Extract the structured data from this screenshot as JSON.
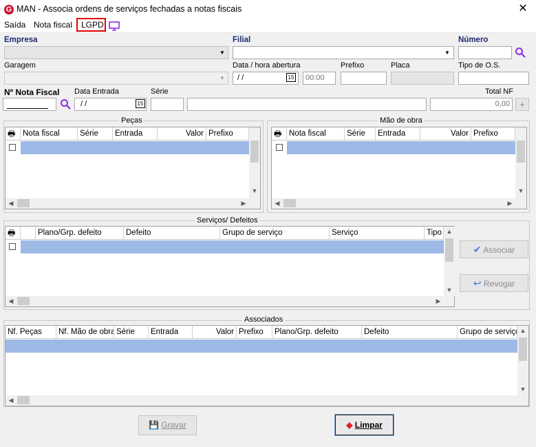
{
  "window": {
    "title": "MAN - Associa ordens de serviços fechadas a notas fiscais",
    "app_icon": "G",
    "close": "✕"
  },
  "menu": {
    "saida": "Saída",
    "nota_fiscal": "Nota fiscal",
    "lgpd": "LGPD"
  },
  "form": {
    "empresa_label": "Empresa",
    "filial_label": "Filial",
    "numero_label": "Número",
    "garagem_label": "Garagem",
    "data_hora_label": "Data / hora abertura",
    "data_value": " /  /",
    "hora_value": "00:00",
    "prefixo_label": "Prefixo",
    "placa_label": "Placa",
    "tipo_os_label": "Tipo de O.S.",
    "nota_fiscal_label": "Nº Nota Fiscal",
    "data_entrada_label": "Data Entrada",
    "data_entrada_value": " /  /",
    "serie_label": "Série",
    "total_nf_label": "Total NF",
    "total_nf_value": "0,00",
    "calendar_glyph": "15",
    "plus_glyph": "+"
  },
  "pecas": {
    "title": "Peças",
    "columns": [
      "Nota fiscal",
      "Série",
      "Entrada",
      "Valor",
      "Prefixo"
    ]
  },
  "mao_obra": {
    "title": "Mão de obra",
    "columns": [
      "Nota fiscal",
      "Série",
      "Entrada",
      "Valor",
      "Prefixo"
    ]
  },
  "servicos": {
    "title": "Serviços/ Defeitos",
    "columns": [
      "Plano/Grp. defeito",
      "Defeito",
      "Grupo de serviço",
      "Serviço",
      "Tipo"
    ]
  },
  "buttons": {
    "associar": "Associar",
    "revogar": "Revogar",
    "gravar": "Gravar",
    "limpar": "Limpar"
  },
  "associados": {
    "title": "Associados",
    "columns": [
      "Nf. Peças",
      "Nf. Mão de obra",
      "Série",
      "Entrada",
      "Valor",
      "Prefixo",
      "Plano/Grp. defeito",
      "Defeito",
      "Grupo de serviço"
    ]
  },
  "colors": {
    "selected_row": "#9db9e6",
    "accent_purple": "#8b2be2",
    "brand_red": "#c8102e"
  }
}
